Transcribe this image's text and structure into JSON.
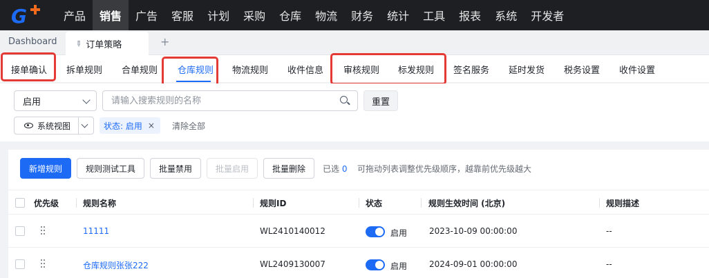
{
  "logo": {
    "text": "G"
  },
  "topnav": {
    "items": [
      "产品",
      "销售",
      "广告",
      "客服",
      "计划",
      "采购",
      "仓库",
      "物流",
      "财务",
      "统计",
      "工具",
      "报表",
      "系统",
      "开发者"
    ],
    "active_index": 1
  },
  "tabs": {
    "dashboard": "Dashboard",
    "active": "订单策略",
    "add": "+"
  },
  "subtabs": {
    "items": [
      "接单确认",
      "拆单规则",
      "合单规则",
      "仓库规则",
      "物流规则",
      "收件信息",
      "审核规则",
      "标发规则",
      "签名服务",
      "延时发货",
      "税务设置",
      "收件设置"
    ],
    "active_index": 3
  },
  "filter": {
    "status_value": "启用",
    "search_placeholder": "请输入搜索规则的名称",
    "reset_label": "重置",
    "view_label": "系统视图",
    "chip_label": "状态: 启用",
    "chip_close": "×",
    "clear_all": "清除全部"
  },
  "toolbar": {
    "new_rule": "新增规则",
    "test_tool": "规则测试工具",
    "batch_disable": "批量禁用",
    "batch_enable": "批量启用",
    "batch_delete": "批量删除",
    "selected_prefix": "已选",
    "selected_count": "0",
    "hint": "可拖动列表调整优先级顺序，越靠前优先级越大"
  },
  "table": {
    "columns": [
      "优先级",
      "规则名称",
      "规则ID",
      "状态",
      "规则生效时间 (北京)",
      "规则描述"
    ],
    "rows": [
      {
        "name": "11111",
        "id": "WL2410140012",
        "status": "启用",
        "time": "2023-10-09 00:00:00",
        "desc": "--"
      },
      {
        "name": "仓库规则张张222",
        "id": "WL2409130007",
        "status": "启用",
        "time": "2024-09-01 00:00:00",
        "desc": "--"
      }
    ]
  },
  "colors": {
    "accent": "#1d6bf5",
    "annotation": "#e53935",
    "nav_bg": "#1e1f22"
  }
}
